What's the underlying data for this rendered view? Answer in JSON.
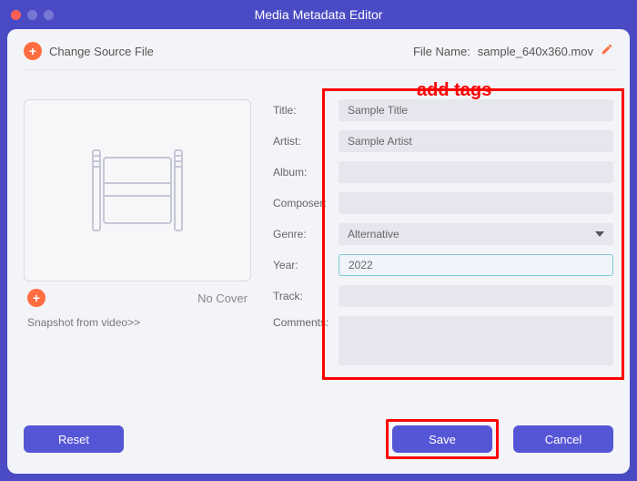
{
  "window": {
    "title": "Media Metadata Editor"
  },
  "header": {
    "change_source": "Change Source File",
    "filename_label": "File Name:",
    "filename_value": "sample_640x360.mov"
  },
  "annotation": "add tags",
  "cover": {
    "no_cover": "No Cover",
    "snapshot_link": "Snapshot from video>>"
  },
  "form": {
    "title_label": "Title:",
    "title_value": "Sample Title",
    "artist_label": "Artist:",
    "artist_value": "Sample Artist",
    "album_label": "Album:",
    "album_value": "",
    "composer_label": "Composer:",
    "composer_value": "",
    "genre_label": "Genre:",
    "genre_value": "Alternative",
    "year_label": "Year:",
    "year_value": "2022",
    "track_label": "Track:",
    "track_value": "",
    "comments_label": "Comments:",
    "comments_value": ""
  },
  "buttons": {
    "reset": "Reset",
    "save": "Save",
    "cancel": "Cancel"
  }
}
